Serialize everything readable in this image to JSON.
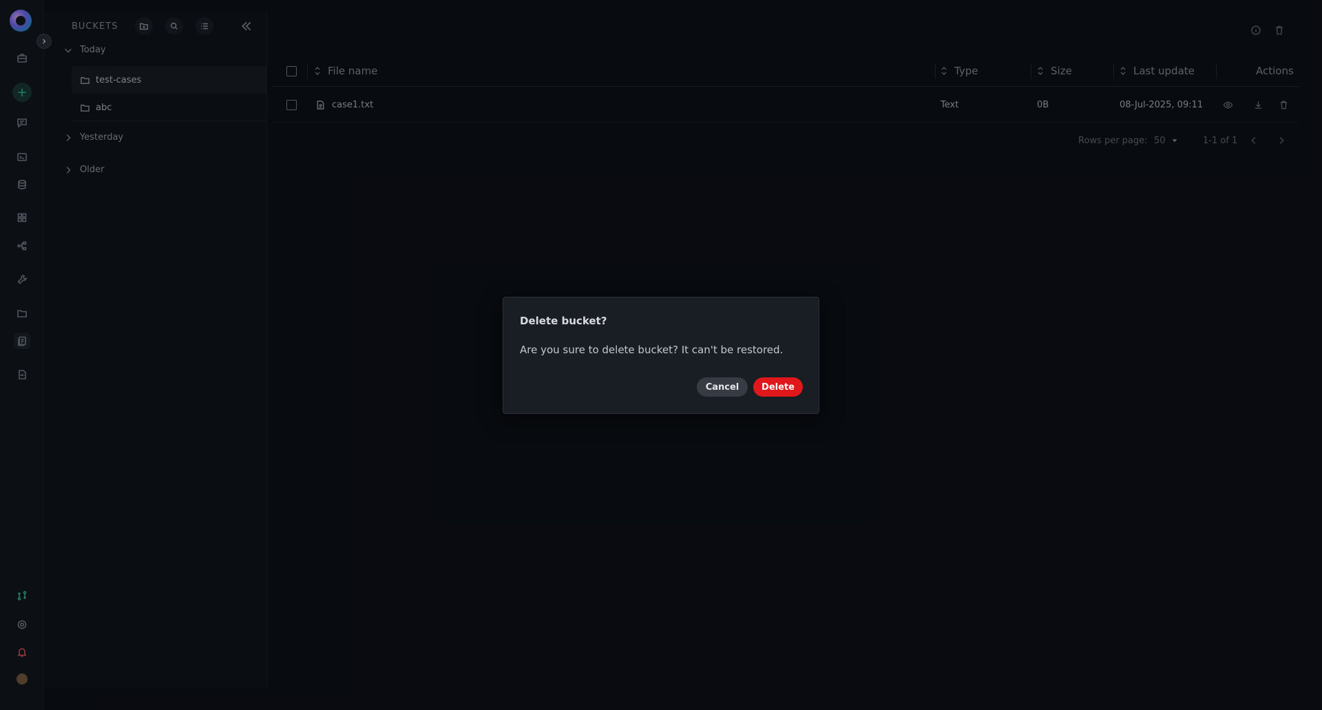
{
  "sidebar": {
    "items": [
      "briefcase-icon",
      "chat-icon",
      "terminal-icon",
      "database-icon",
      "apps-icon",
      "workflow-icon",
      "tools-icon",
      "folder-icon",
      "bucket-icon",
      "report-icon"
    ],
    "bottom": [
      "git-icon",
      "settings-icon",
      "bell-icon",
      "avatar"
    ]
  },
  "buckets": {
    "title": "BUCKETS",
    "groups": {
      "today": "Today",
      "yesterday": "Yesterday",
      "older": "Older"
    },
    "items": [
      {
        "name": "test-cases"
      },
      {
        "name": "abc"
      }
    ]
  },
  "table": {
    "columns": {
      "file_name": "File name",
      "type": "Type",
      "size": "Size",
      "last_update": "Last update",
      "actions": "Actions"
    },
    "rows": [
      {
        "file_name": "case1.txt",
        "type": "Text",
        "size": "0B",
        "last_update": "08-Jul-2025, 09:11"
      }
    ]
  },
  "pagination": {
    "rows_per_page_label": "Rows per page:",
    "rows_per_page": "50",
    "range": "1-1 of 1"
  },
  "dialog": {
    "title": "Delete bucket?",
    "message": "Are you sure to delete bucket? It can't be restored.",
    "cancel_label": "Cancel",
    "delete_label": "Delete"
  },
  "colors": {
    "accent": "#33c29a",
    "danger": "#e0181b"
  }
}
